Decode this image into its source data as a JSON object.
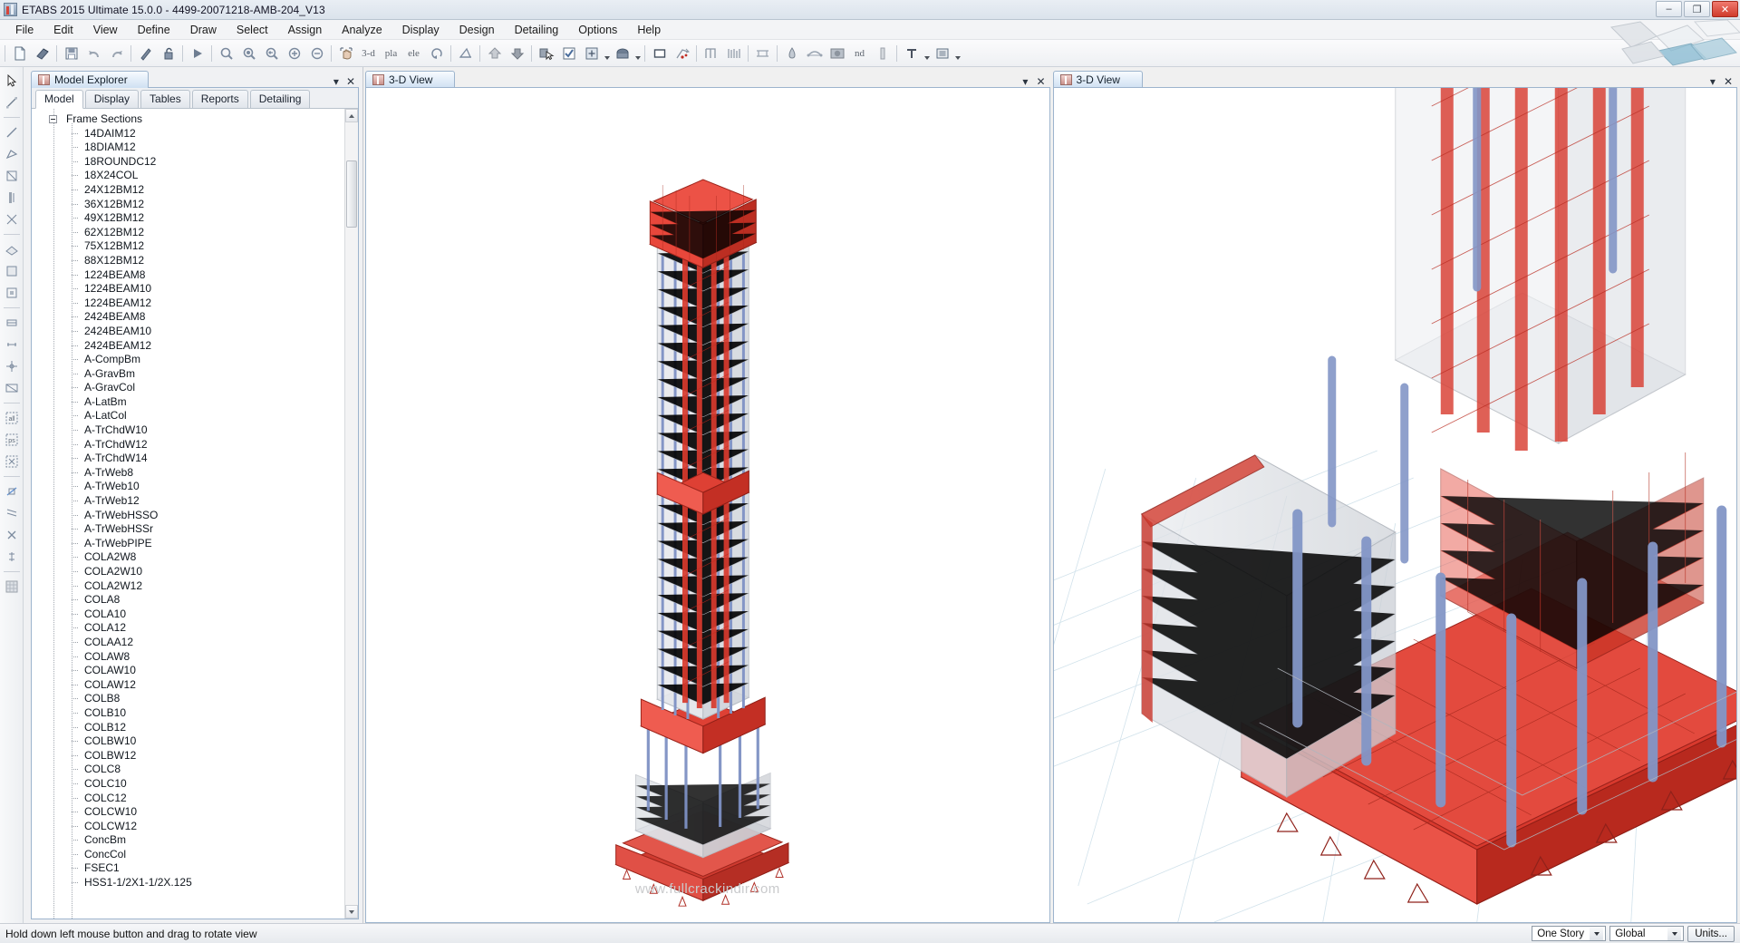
{
  "window": {
    "title": "ETABS 2015 Ultimate 15.0.0 - 4499-20071218-AMB-204_V13",
    "icon": "etabs-icon",
    "minimize": "–",
    "maximize": "❐",
    "close": "✕"
  },
  "menubar": {
    "items": [
      {
        "label": "File"
      },
      {
        "label": "Edit"
      },
      {
        "label": "View"
      },
      {
        "label": "Define"
      },
      {
        "label": "Draw"
      },
      {
        "label": "Select"
      },
      {
        "label": "Assign"
      },
      {
        "label": "Analyze"
      },
      {
        "label": "Display"
      },
      {
        "label": "Design"
      },
      {
        "label": "Detailing"
      },
      {
        "label": "Options"
      },
      {
        "label": "Help"
      }
    ]
  },
  "toolbar": {
    "text_buttons": [
      "3-d",
      "pla",
      "ele",
      "nd"
    ],
    "icons": [
      "new-model-icon",
      "open-model-icon",
      "save-icon",
      "undo-icon",
      "redo-icon",
      "refresh-icon",
      "lock-icon",
      "run-analysis-icon",
      "rubber-band-zoom-icon",
      "restore-full-view-icon",
      "previous-zoom-icon",
      "zoom-in-icon",
      "zoom-out-icon",
      "pan-icon",
      "3d-view-icon",
      "plan-view-icon",
      "elevation-view-icon",
      "rotate-3d-icon",
      "perspective-toggle-icon",
      "up-one-story-icon",
      "down-one-story-icon",
      "select-object-icon",
      "assign-icon",
      "set-display-options-icon",
      "object-fill-icon",
      "extrude-view-icon",
      "show-undeformed-shape-icon",
      "display-load-icon",
      "section-cut-icon",
      "show-deformed-shape-icon",
      "show-forces-icon",
      "render-view-icon",
      "nodes-icon",
      "show-tables-icon",
      "label-text-icon",
      "snapshot-icon"
    ]
  },
  "left_tool_strip": {
    "icons": [
      "pointer-icon",
      "reshape-icon",
      "draw-line-icon",
      "draw-poly-icon",
      "quick-draw-beam-icon",
      "quick-draw-column-icon",
      "quick-draw-brace-icon",
      "draw-floor-icon",
      "draw-wall-icon",
      "quick-draw-area-icon",
      "draw-section-cut-icon",
      "draw-dimension-icon",
      "draw-reference-point-icon",
      "draw-developed-elevation-icon",
      "select-all-icon",
      "get-previous-selection-icon",
      "clear-selection-icon",
      "select-by-intersecting-line-icon",
      "select-by-story-icon",
      "deselect-icon",
      "set-limits-icon",
      "select-by-property-icon",
      "snap-grid-icon"
    ]
  },
  "explorer": {
    "panel_title": "Model Explorer",
    "panel_icon": "model-explorer-icon",
    "dock_menu_icon": "▾",
    "close_icon": "✕",
    "tabs": [
      {
        "label": "Model",
        "active": true
      },
      {
        "label": "Display",
        "active": false
      },
      {
        "label": "Tables",
        "active": false
      },
      {
        "label": "Reports",
        "active": false
      },
      {
        "label": "Detailing",
        "active": false
      }
    ],
    "tree_root": "Frame Sections",
    "tree_items": [
      "14DAIM12",
      "18DIAM12",
      "18ROUNDC12",
      "18X24COL",
      "24X12BM12",
      "36X12BM12",
      "49X12BM12",
      "62X12BM12",
      "75X12BM12",
      "88X12BM12",
      "1224BEAM8",
      "1224BEAM10",
      "1224BEAM12",
      "2424BEAM8",
      "2424BEAM10",
      "2424BEAM12",
      "A-CompBm",
      "A-GravBm",
      "A-GravCol",
      "A-LatBm",
      "A-LatCol",
      "A-TrChdW10",
      "A-TrChdW12",
      "A-TrChdW14",
      "A-TrWeb8",
      "A-TrWeb10",
      "A-TrWeb12",
      "A-TrWebHSSO",
      "A-TrWebHSSr",
      "A-TrWebPIPE",
      "COLA2W8",
      "COLA2W10",
      "COLA2W12",
      "COLA8",
      "COLA10",
      "COLA12",
      "COLAA12",
      "COLAW8",
      "COLAW10",
      "COLAW12",
      "COLB8",
      "COLB10",
      "COLB12",
      "COLBW10",
      "COLBW12",
      "COLC8",
      "COLC10",
      "COLC12",
      "COLCW10",
      "COLCW12",
      "ConcBm",
      "ConcCol",
      "FSEC1",
      "HSS1-1/2X1-1/2X.125"
    ],
    "scroll_up_icon": "scroll-up-arrow",
    "scroll_down_icon": "scroll-down-arrow"
  },
  "views": [
    {
      "tab_label": "3-D View",
      "tab_icon": "3d-view-icon",
      "dock_menu_icon": "▾",
      "close_icon": "✕",
      "watermark": "www.fullcrackindir.com"
    },
    {
      "tab_label": "3-D View",
      "tab_icon": "3d-view-icon",
      "dock_menu_icon": "▾",
      "close_icon": "✕",
      "watermark": ""
    }
  ],
  "statusbar": {
    "message": "Hold down left mouse button and drag to rotate view",
    "story_selector": "One Story",
    "coord_system_selector": "Global",
    "units_button": "Units..."
  },
  "colors": {
    "model_red": "#d6302a",
    "model_blue": "#8b9dc8",
    "model_gray": "#d8dbe0",
    "canvas_bg": "#ffffff",
    "accent_tab": "#cfe0f2",
    "watermark_gray": "#c9cacc"
  }
}
